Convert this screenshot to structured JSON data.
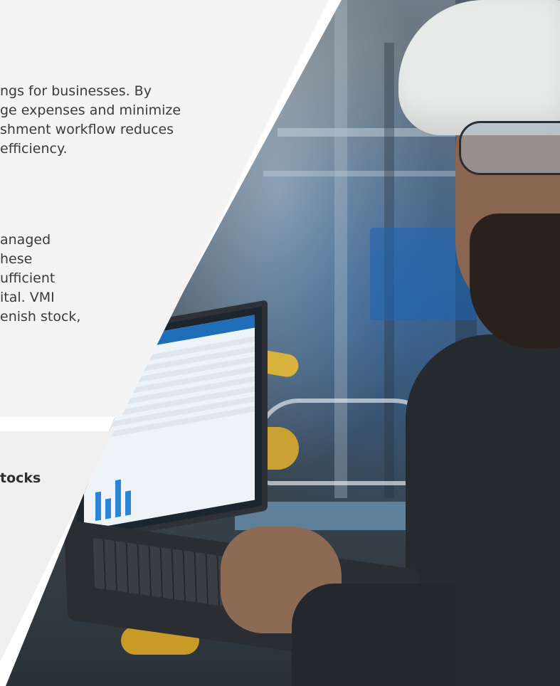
{
  "section_top": {
    "paragraph_1": [
      "ngs for businesses. By",
      "ge expenses and minimize",
      "shment workflow reduces",
      "efficiency."
    ],
    "paragraph_2": [
      "anaged",
      "hese",
      "ufficient",
      "ital. VMI",
      "enish stock,"
    ]
  },
  "section_bottom": {
    "subheading": "tocks"
  },
  "photo": {
    "subject": "industrial-worker-with-laptop-photo"
  },
  "colors": {
    "panel_top": "#f4f4f4",
    "panel_bottom": "#f0f0f0",
    "text": "#3a3a3a",
    "screen_accent": "#1f6fb8"
  }
}
